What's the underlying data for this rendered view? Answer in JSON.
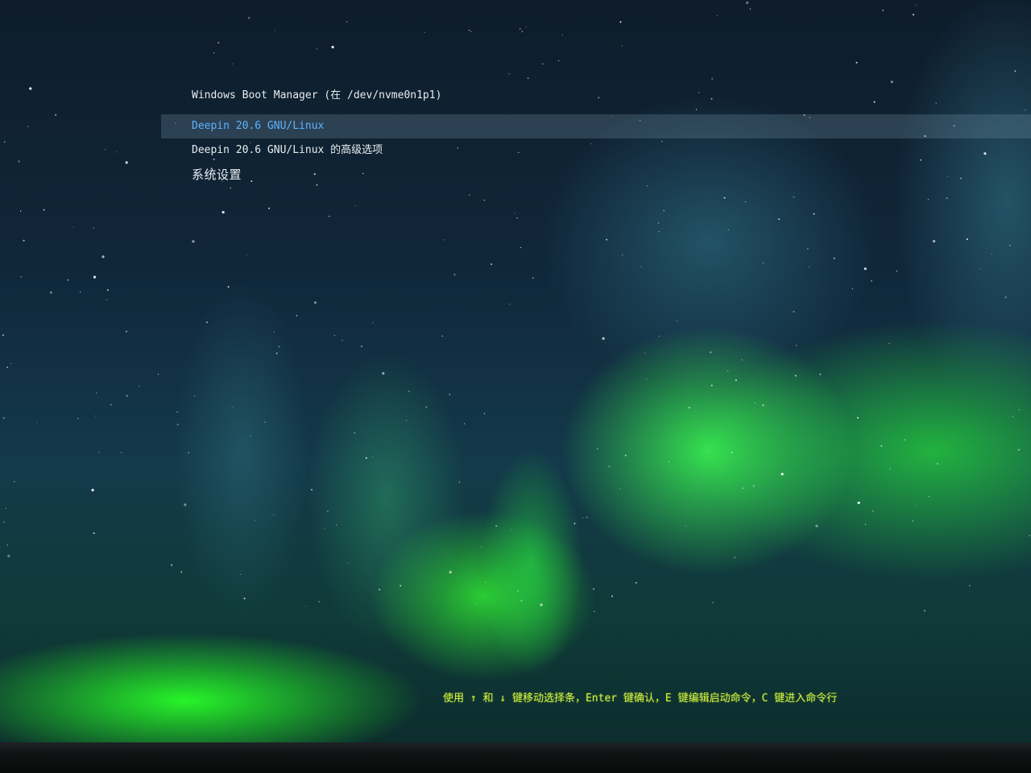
{
  "boot_menu": {
    "entries": [
      {
        "label": "Windows Boot Manager (在 /dev/nvme0n1p1)",
        "selected": false
      },
      {
        "label": "Deepin 20.6 GNU/Linux",
        "selected": true
      },
      {
        "label": "Deepin 20.6 GNU/Linux 的高级选项",
        "selected": false
      },
      {
        "label": "系统设置",
        "selected": false
      }
    ],
    "highlight_color": "#5fb2ff",
    "text_color": "#e8edf0"
  },
  "help_text": "使用 ↑ 和 ↓ 键移动选择条，Enter 键确认，E 键编辑启动命令，C 键进入命令行",
  "colors": {
    "help": "#d6f23a",
    "aurora": "#28ff28",
    "sky": "#10273a"
  }
}
